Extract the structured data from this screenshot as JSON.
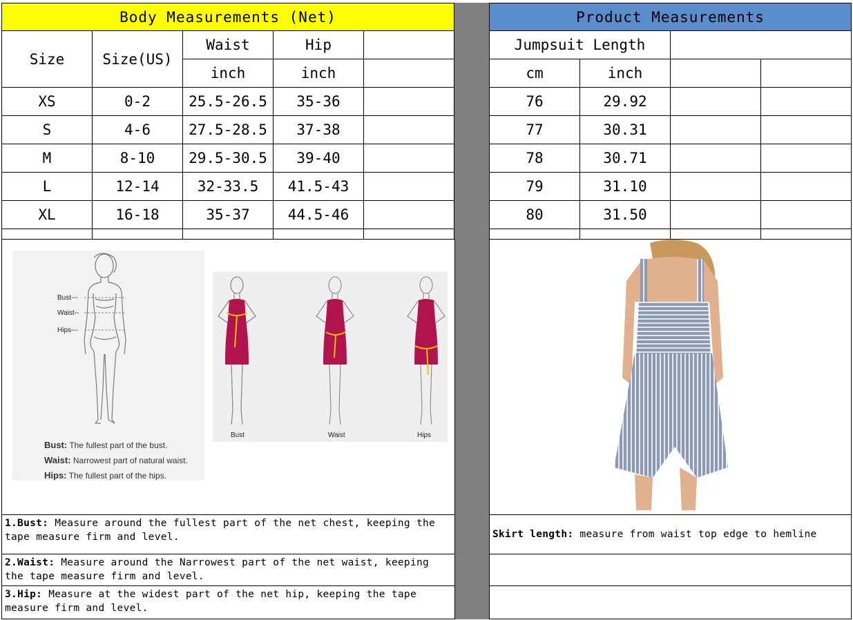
{
  "headers": {
    "body": "Body Measurements (Net)",
    "product": "Product Measurements"
  },
  "columns": {
    "size": "Size",
    "size_us": "Size(US)",
    "waist": "Waist",
    "hip": "Hip",
    "waist_unit": "inch",
    "hip_unit": "inch",
    "jumpsuit_length": "Jumpsuit Length",
    "cm_unit": "cm",
    "inch_unit": "inch"
  },
  "rows": [
    {
      "size": "XS",
      "us": "0-2",
      "waist": "25.5-26.5",
      "hip": "35-36",
      "cm": "76",
      "inch": "29.92"
    },
    {
      "size": "S",
      "us": "4-6",
      "waist": "27.5-28.5",
      "hip": "37-38",
      "cm": "77",
      "inch": "30.31"
    },
    {
      "size": "M",
      "us": "8-10",
      "waist": "29.5-30.5",
      "hip": "39-40",
      "cm": "78",
      "inch": "30.71"
    },
    {
      "size": "L",
      "us": "12-14",
      "waist": "32-33.5",
      "hip": "41.5-43",
      "cm": "79",
      "inch": "31.10"
    },
    {
      "size": "XL",
      "us": "16-18",
      "waist": "35-37",
      "hip": "44.5-46",
      "cm": "80",
      "inch": "31.50"
    }
  ],
  "figure_left": {
    "labels": {
      "bust": "Bust---",
      "waist": "Waist--",
      "hips": "Hips---"
    },
    "legend": [
      {
        "term": "Bust:",
        "desc": "The fullest part of the bust."
      },
      {
        "term": "Waist:",
        "desc": "Narrowest part of natural waist."
      },
      {
        "term": "Hips:",
        "desc": "The fullest part of the hips."
      }
    ]
  },
  "figure_middle": {
    "captions": [
      "Bust",
      "Waist",
      "Hips"
    ],
    "dress_color": "#b0134e",
    "tape_color": "#f2c100"
  },
  "notes": [
    {
      "term": "1.Bust:",
      "text": "  Measure around the fullest part of the net chest, keeping the tape  measure firm and level."
    },
    {
      "term": "2.Waist:",
      "text": " Measure around the Narrowest part of the net waist, keeping the tape  measure firm and level."
    },
    {
      "term": "3.Hip:",
      "text": " Measure at the widest part of the net hip, keeping the tape measure firm and level."
    }
  ],
  "product_note": {
    "term": "Skirt length:",
    "text": " measure from waist top edge to hemline"
  },
  "colors": {
    "body_header": "#ffff00",
    "product_header": "#5b8ccc",
    "divider": "#808080",
    "romper_stripe": "#7d8aa3"
  }
}
